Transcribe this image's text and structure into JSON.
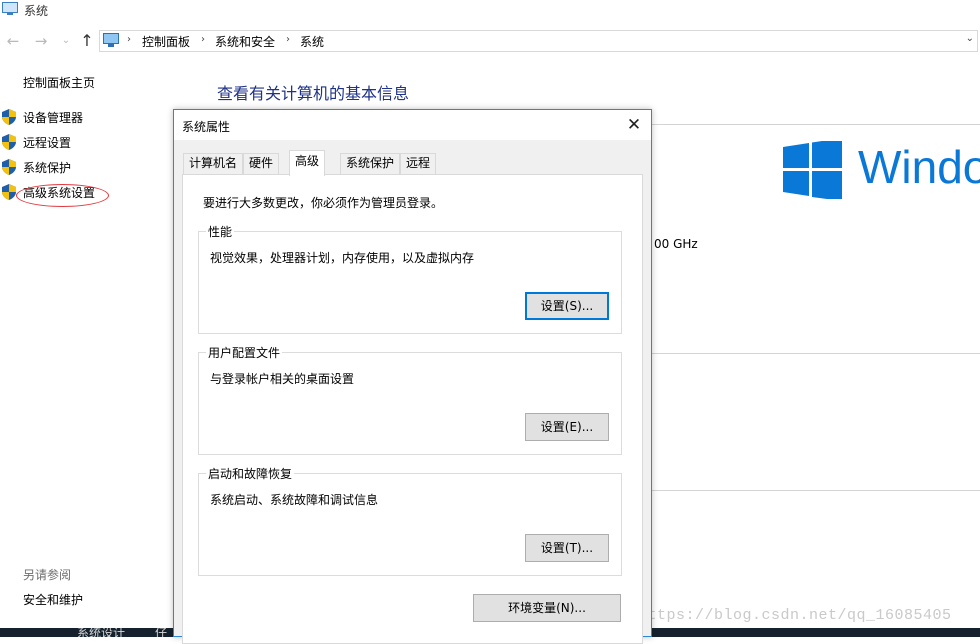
{
  "window": {
    "title": "系统"
  },
  "nav": {
    "back": "←",
    "forward": "→",
    "recent": "⌄",
    "up": "↑"
  },
  "address": {
    "crumbs": [
      "控制面板",
      "系统和安全",
      "系统"
    ],
    "sep": "›",
    "dropdown": "⌄"
  },
  "sidebar": {
    "home": "控制面板主页",
    "items": [
      {
        "label": "设备管理器"
      },
      {
        "label": "远程设置"
      },
      {
        "label": "系统保护"
      },
      {
        "label": "高级系统设置"
      }
    ],
    "see_also": "另请参阅",
    "security": "安全和维护"
  },
  "main": {
    "title": "查看有关计算机的基本信息",
    "cpu_fragment": "00 GHz",
    "windows_brand": "Windo"
  },
  "taskbar": {
    "items": [
      "系统设计",
      "仔"
    ]
  },
  "watermark": "https://blog.csdn.net/qq_16085405",
  "dialog": {
    "title": "系统属性",
    "close": "✕",
    "tabs": [
      "计算机名",
      "硬件",
      "高级",
      "系统保护",
      "远程"
    ],
    "active_tab": "高级",
    "admin_note": "要进行大多数更改，你必须作为管理员登录。",
    "performance": {
      "title": "性能",
      "desc": "视觉效果，处理器计划，内存使用，以及虚拟内存",
      "button": "设置(S)..."
    },
    "profiles": {
      "title": "用户配置文件",
      "desc": "与登录帐户相关的桌面设置",
      "button": "设置(E)..."
    },
    "startup": {
      "title": "启动和故障恢复",
      "desc": "系统启动、系统故障和调试信息",
      "button": "设置(T)..."
    },
    "env_button": "环境变量(N)..."
  },
  "colors": {
    "accent": "#0078d7",
    "title_blue": "#1e3287",
    "windows_blue": "#0a78d7",
    "highlight_ellipse": "#e0383e"
  }
}
